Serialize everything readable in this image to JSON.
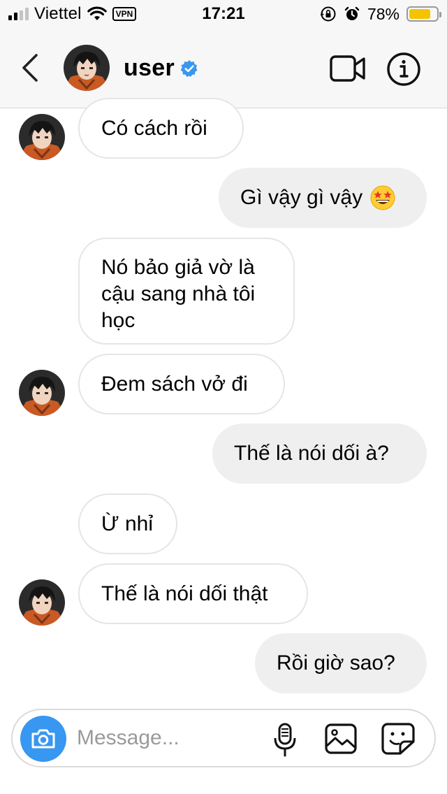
{
  "status_bar": {
    "carrier": "Viettel",
    "vpn": "VPN",
    "time": "17:21",
    "battery_percent": "78%",
    "battery_level": 0.78,
    "signal_bars_active": 2,
    "signal_bars_total": 4
  },
  "header": {
    "username": "user",
    "verified": true,
    "icons": [
      "back-chevron-icon",
      "avatar",
      "verified-badge-icon",
      "video-camera-icon",
      "info-icon"
    ]
  },
  "messages": [
    {
      "side": "incoming",
      "text": "Có cách rồi",
      "show_avatar": true
    },
    {
      "side": "outgoing",
      "text": "Gì vậy gì vậy",
      "emoji": "star-struck-emoji"
    },
    {
      "side": "incoming",
      "text": "Nó bảo giả vờ là cậu sang nhà tôi học",
      "show_avatar": false
    },
    {
      "side": "incoming",
      "text": "Đem sách vở đi",
      "show_avatar": true
    },
    {
      "side": "outgoing",
      "text": "Thế là nói dối à?"
    },
    {
      "side": "incoming",
      "text": "Ừ nhỉ",
      "show_avatar": false
    },
    {
      "side": "incoming",
      "text": "Thế là nói dối thật",
      "show_avatar": true
    },
    {
      "side": "outgoing",
      "text": "Rồi giờ sao?"
    }
  ],
  "composer": {
    "placeholder": "Message...",
    "value": "",
    "icons": [
      "camera-icon",
      "microphone-icon",
      "gallery-icon",
      "sticker-icon"
    ]
  },
  "colors": {
    "accent_blue": "#3897f0",
    "verified_blue": "#3897f0",
    "outgoing_bubble": "#efefef",
    "incoming_border": "#e5e5e5",
    "header_bg": "#f7f7f7",
    "battery_yellow": "#f5c400"
  }
}
